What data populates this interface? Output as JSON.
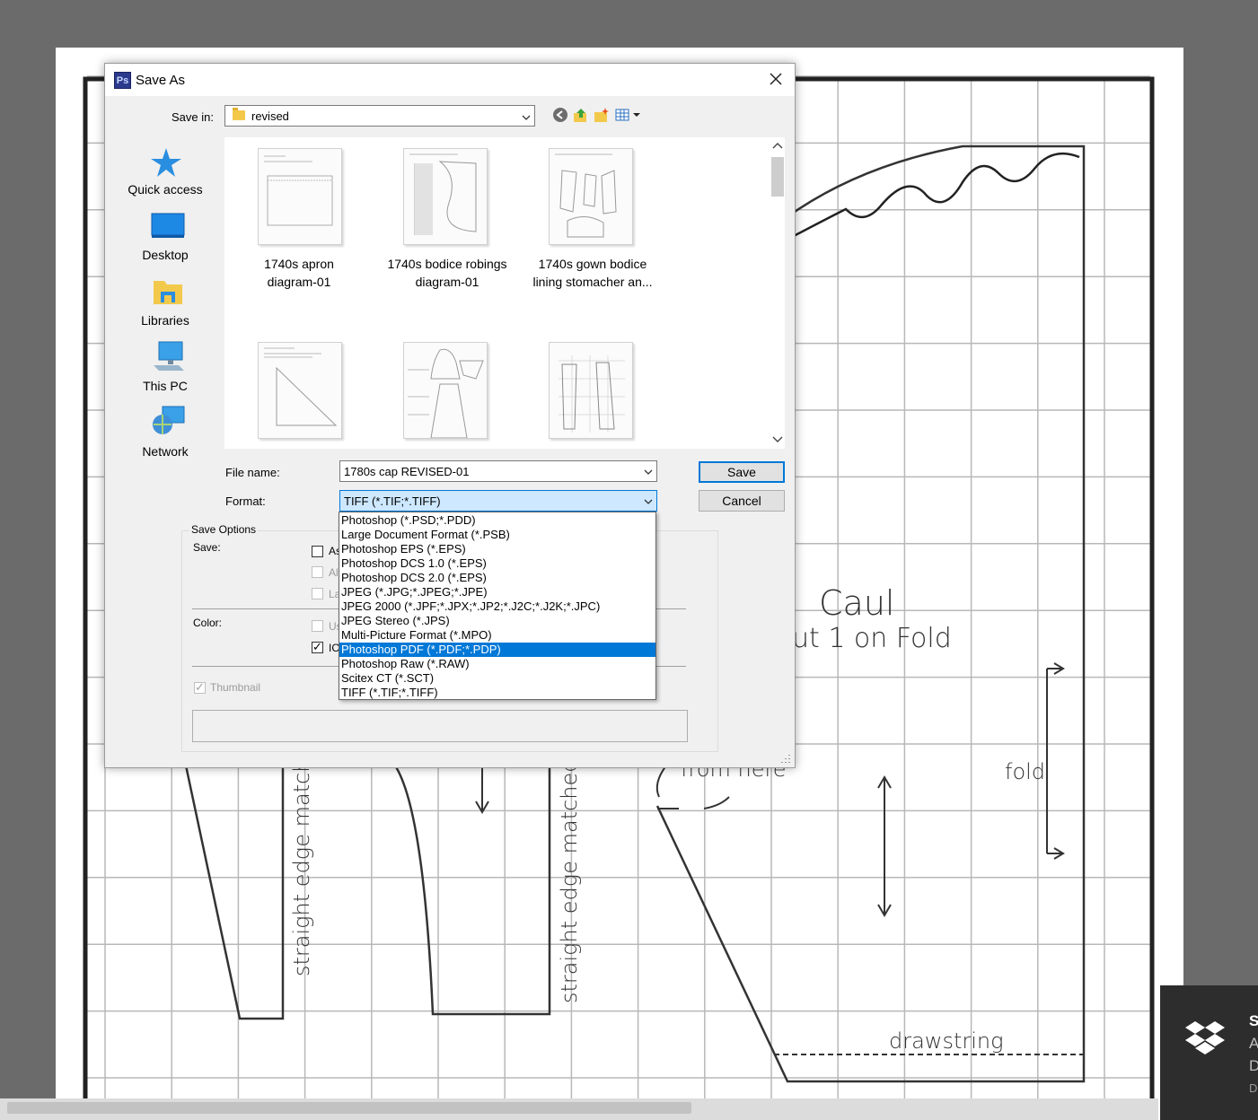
{
  "background_doc": {
    "labels": {
      "caul": "Caul",
      "cut": "ut 1 on Fold",
      "fold": "fold",
      "from_here": "from here",
      "drawstring": "drawstring",
      "straight_edge_1": "straight edge matched t",
      "straight_edge_2": "straight edge matched to b"
    }
  },
  "toast": {
    "title": "S",
    "line1": "A",
    "line2": "D",
    "line3": "D"
  },
  "dialog": {
    "app_icon": "Ps",
    "title": "Save As",
    "save_in_label": "Save in:",
    "save_in_value": "revised",
    "places": [
      {
        "label": "Quick access",
        "icon": "star-icon"
      },
      {
        "label": "Desktop",
        "icon": "desktop-icon"
      },
      {
        "label": "Libraries",
        "icon": "libraries-icon"
      },
      {
        "label": "This PC",
        "icon": "computer-icon"
      },
      {
        "label": "Network",
        "icon": "network-icon"
      }
    ],
    "files": [
      {
        "line1": "1740s apron",
        "line2": "diagram-01"
      },
      {
        "line1": "1740s bodice robings",
        "line2": "diagram-01"
      },
      {
        "line1": "1740s gown bodice",
        "line2": "lining stomacher an..."
      },
      {
        "line1": "",
        "line2": ""
      },
      {
        "line1": "",
        "line2": ""
      },
      {
        "line1": "",
        "line2": ""
      }
    ],
    "file_name_label": "File name:",
    "file_name_value": "1780s cap REVISED-01",
    "format_label": "Format:",
    "format_value": "TIFF (*.TIF;*.TIFF)",
    "save_button": "Save",
    "cancel_button": "Cancel",
    "save_options": {
      "title": "Save Options",
      "save_label": "Save:",
      "color_label": "Color:",
      "opt_as": "As",
      "opt_al": "Al",
      "opt_la": "La",
      "opt_us": "Us",
      "opt_ic": "IC",
      "thumbnail": "Thumbnail"
    },
    "format_options": [
      "Photoshop (*.PSD;*.PDD)",
      "Large Document Format (*.PSB)",
      "Photoshop EPS (*.EPS)",
      "Photoshop DCS 1.0 (*.EPS)",
      "Photoshop DCS 2.0 (*.EPS)",
      "JPEG (*.JPG;*.JPEG;*.JPE)",
      "JPEG 2000 (*.JPF;*.JPX;*.JP2;*.J2C;*.J2K;*.JPC)",
      "JPEG Stereo (*.JPS)",
      "Multi-Picture Format (*.MPO)",
      "Photoshop PDF (*.PDF;*.PDP)",
      "Photoshop Raw (*.RAW)",
      "Scitex CT (*.SCT)",
      "TIFF (*.TIF;*.TIFF)"
    ],
    "format_selected_index": 9
  }
}
